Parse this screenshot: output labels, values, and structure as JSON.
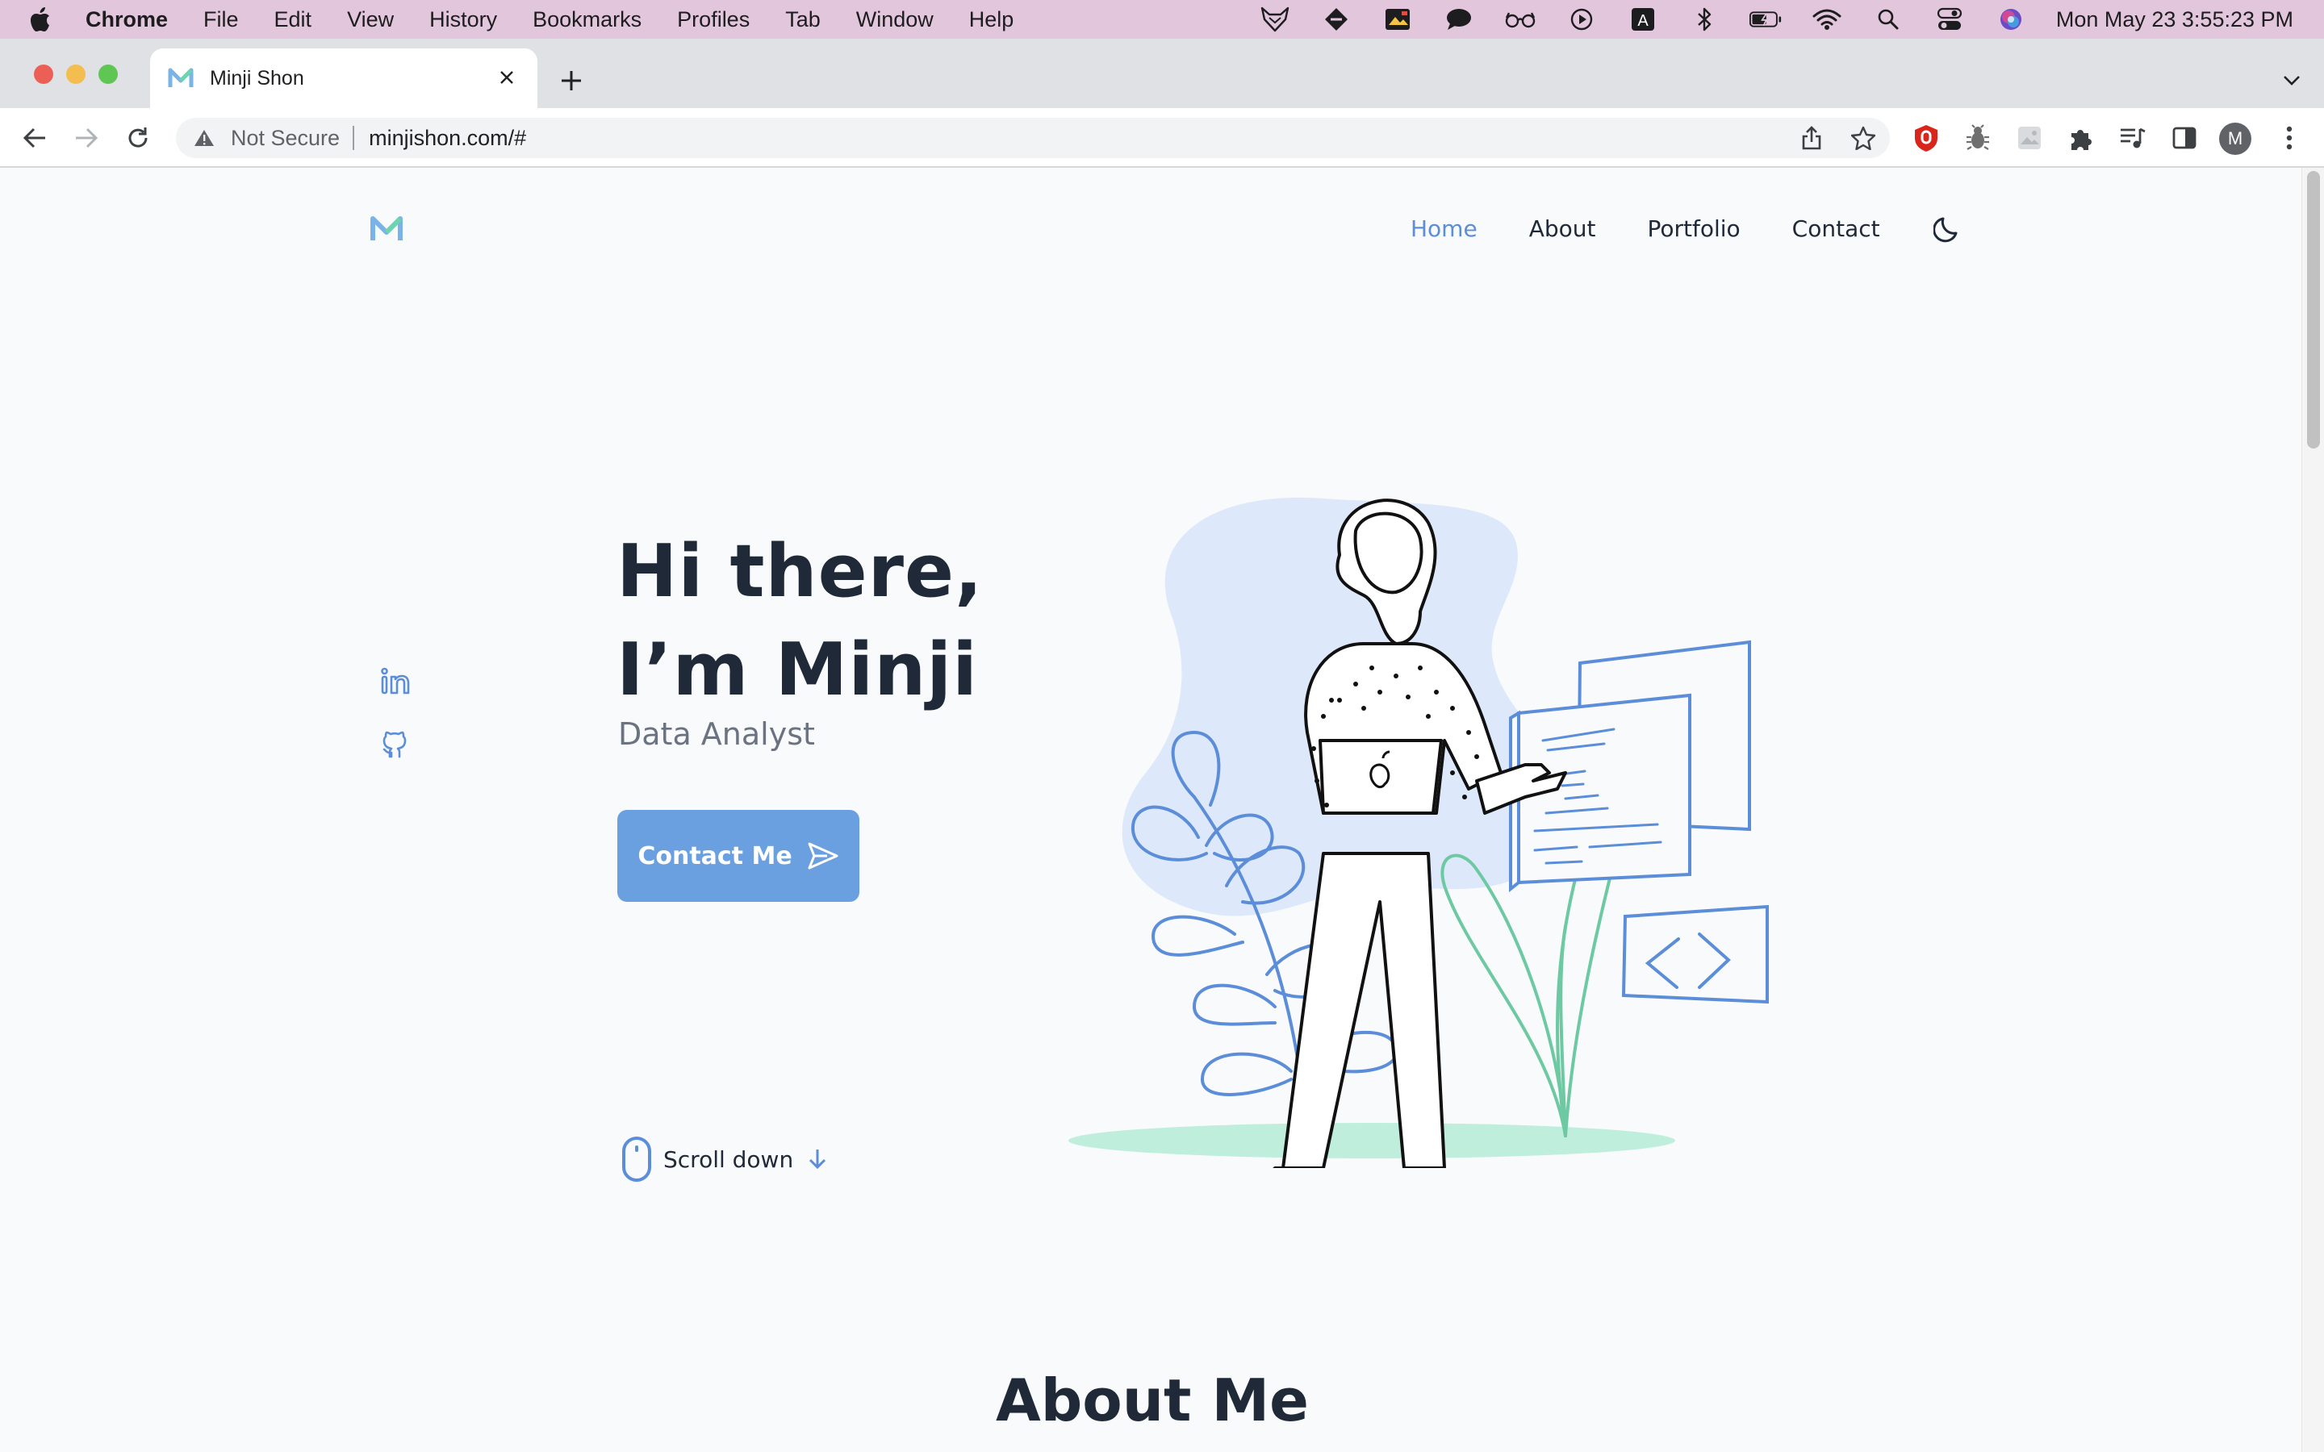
{
  "menubar": {
    "app_name": "Chrome",
    "items": [
      "File",
      "Edit",
      "View",
      "History",
      "Bookmarks",
      "Profiles",
      "Tab",
      "Window",
      "Help"
    ],
    "clock": "Mon May 23  3:55:23 PM"
  },
  "browser": {
    "tab_title": "Minji Shon",
    "security_label": "Not Secure",
    "url": "minjishon.com/#",
    "profile_initial": "M"
  },
  "site": {
    "logo_letter": "M",
    "nav": {
      "home": "Home",
      "about": "About",
      "portfolio": "Portfolio",
      "contact": "Contact"
    },
    "hero": {
      "title_line1": "Hi there,",
      "title_line2": "I’m Minji",
      "subtitle": "Data Analyst",
      "cta_label": "Contact Me"
    },
    "scroll_label": "Scroll down",
    "about_heading": "About Me"
  },
  "colors": {
    "accent": "#6a9fe0",
    "nav_active": "#5b8dd9",
    "text_dark": "#1f2937",
    "blob": "#dde9fa",
    "leaf_green": "#6cc9a1"
  }
}
